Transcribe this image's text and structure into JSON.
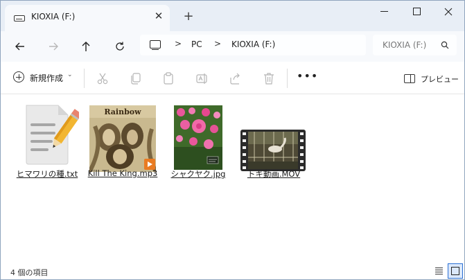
{
  "window": {
    "tab_title": "KIOXIA (F:)",
    "tab_close_glyph": "✕",
    "new_tab_glyph": "+",
    "controls": [
      "minimize",
      "maximize",
      "close"
    ]
  },
  "address_bar": {
    "icon": "monitor-icon",
    "breadcrumbs": [
      "PC",
      "KIOXIA (F:)"
    ],
    "separator": ">"
  },
  "search": {
    "placeholder": "KIOXIA (F:)",
    "icon": "search-icon"
  },
  "toolbar": {
    "new_label": "新規作成",
    "new_caret": "⌄",
    "more_label": "•••",
    "preview_label": "プレビュー",
    "icons": [
      "cut-icon",
      "copy-icon",
      "paste-icon",
      "rename-icon",
      "share-icon",
      "delete-icon"
    ]
  },
  "files": [
    {
      "name": "ヒマワリの種.txt",
      "kind": "text",
      "icon": "notepad-icon"
    },
    {
      "name": "Kill The King.mp3",
      "kind": "audio",
      "icon": "album-art-thumbnail",
      "album_text": "Rainbow"
    },
    {
      "name": "シャクヤク.jpg",
      "kind": "image",
      "icon": "flower-photo-thumbnail"
    },
    {
      "name": "トキ動画.MOV",
      "kind": "video",
      "icon": "film-strip-thumbnail"
    }
  ],
  "status": {
    "item_count_text": "4 個の項目",
    "views": [
      "details-view",
      "large-icons-view"
    ],
    "active_view": "large-icons-view"
  },
  "colors": {
    "title_bar": "#e8eef6",
    "nav_bar": "#f7f9fc",
    "accent": "#2a6fd4",
    "play_badge": "#e97b22"
  }
}
